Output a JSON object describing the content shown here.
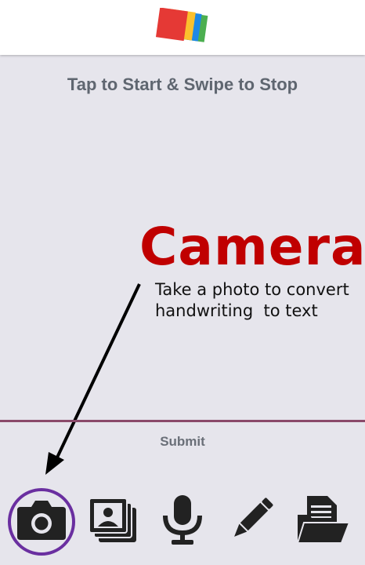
{
  "instruction": "Tap to Start & Swipe to Stop",
  "callout": {
    "title": "Camera",
    "line1": "Take a photo to convert",
    "line2": "handwriting  to text"
  },
  "submit_label": "Submit",
  "toolbar": {
    "items": [
      {
        "icon": "camera-icon",
        "selected": true
      },
      {
        "icon": "gallery-icon",
        "selected": false
      },
      {
        "icon": "microphone-icon",
        "selected": false
      },
      {
        "icon": "pencil-icon",
        "selected": false
      },
      {
        "icon": "folder-icon",
        "selected": false
      }
    ]
  },
  "colors": {
    "background": "#e6e5ec",
    "callout_title": "#c00000",
    "divider": "#8b4a6a",
    "selection_ring": "#6a2fa0",
    "icon": "#222222"
  }
}
